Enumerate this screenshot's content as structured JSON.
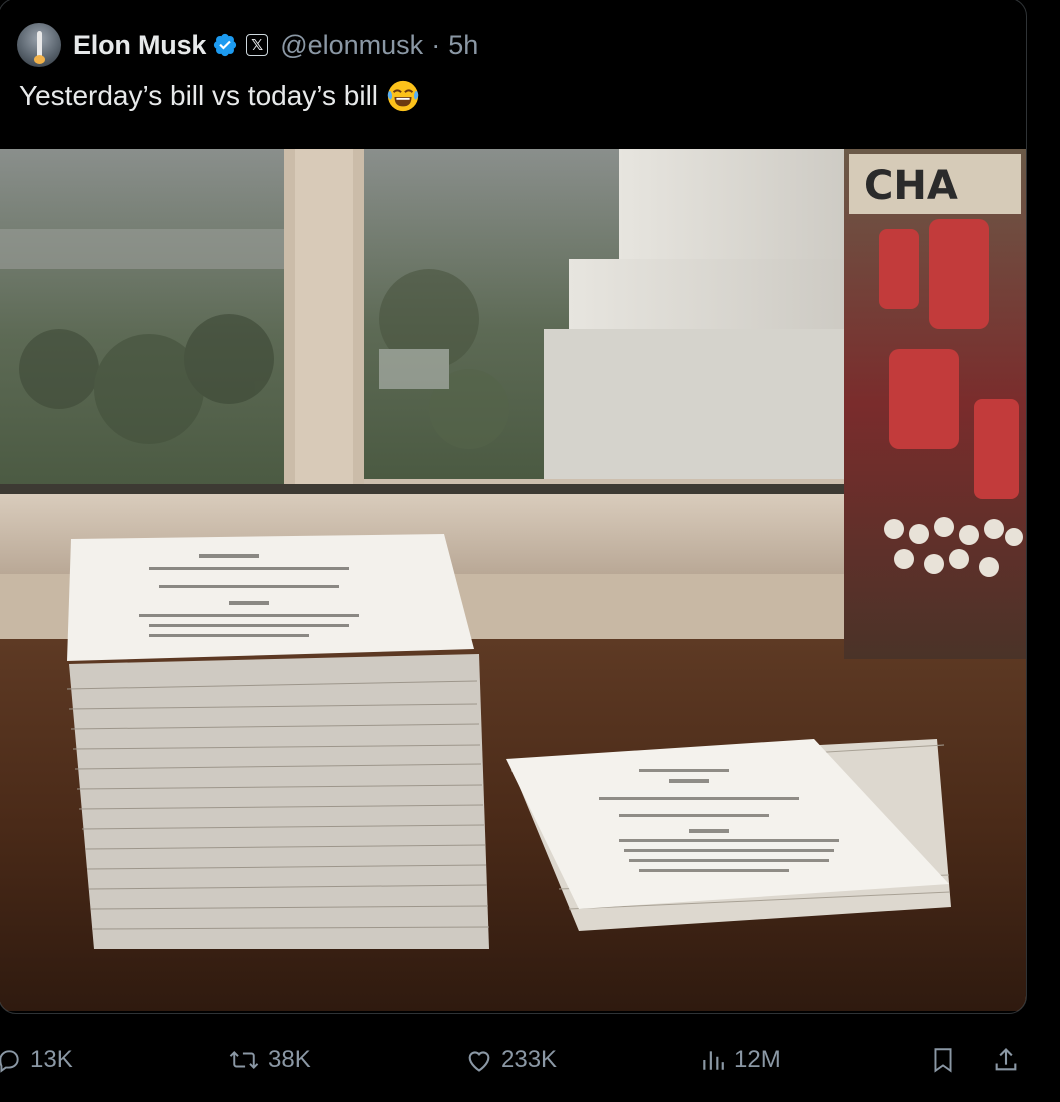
{
  "post": {
    "author_name": "Elon Musk",
    "handle": "@elonmusk",
    "separator": "·",
    "time": "5h",
    "text": "Yesterday’s bill vs today’s bill",
    "x_badge": "𝕏",
    "icons": {
      "avatar": "rocket-launch-avatar",
      "verified": "verified-badge-icon",
      "affiliate": "x-logo-badge-icon",
      "emoji": "face-with-tears-of-joy-emoji"
    },
    "colors": {
      "background": "#000000",
      "text": "#e7e9ea",
      "muted": "#8b98a5",
      "verified": "#1d9bf0"
    }
  },
  "actions": {
    "reply_count": "13K",
    "repost_count": "38K",
    "like_count": "233K",
    "view_count": "12M",
    "icons": [
      "reply-icon",
      "repost-icon",
      "like-icon",
      "views-icon",
      "bookmark-icon",
      "share-icon"
    ]
  }
}
